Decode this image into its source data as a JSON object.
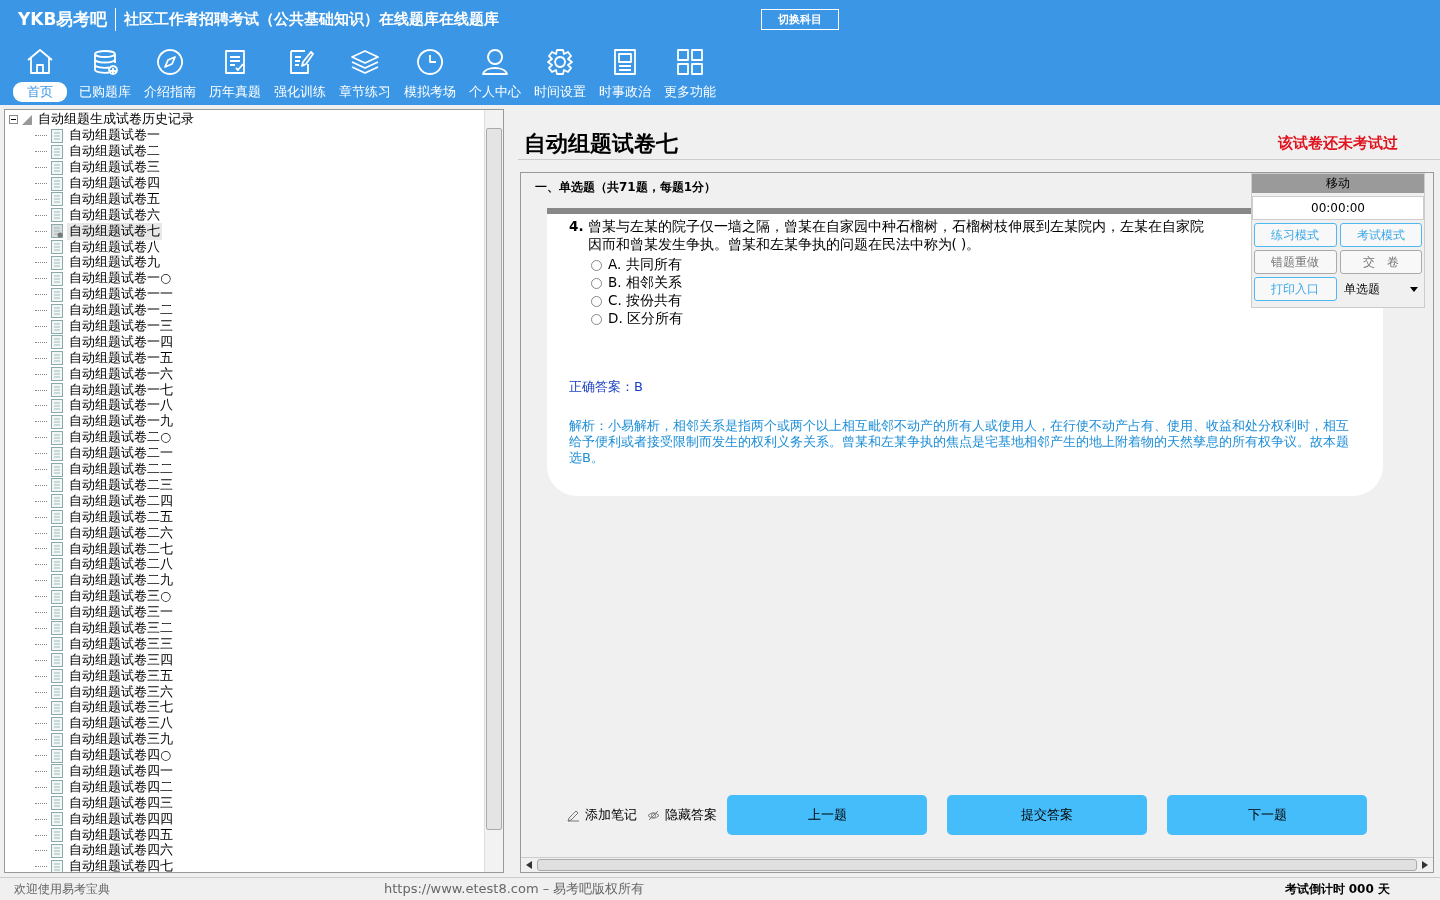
{
  "header": {
    "logo": "YKB易考吧",
    "title": "社区工作者招聘考试（公共基础知识）在线题库在线题库",
    "switch_button": "切换科目"
  },
  "nav": [
    {
      "label": "首页",
      "selected": true
    },
    {
      "label": "已购题库",
      "selected": false
    },
    {
      "label": "介绍指南",
      "selected": false
    },
    {
      "label": "历年真题",
      "selected": false
    },
    {
      "label": "强化训练",
      "selected": false
    },
    {
      "label": "章节练习",
      "selected": false
    },
    {
      "label": "模拟考场",
      "selected": false
    },
    {
      "label": "个人中心",
      "selected": false
    },
    {
      "label": "时间设置",
      "selected": false
    },
    {
      "label": "时事政治",
      "selected": false
    },
    {
      "label": "更多功能",
      "selected": false
    }
  ],
  "tree": {
    "root": {
      "label": "自动组题生成试卷历史记录",
      "expanded": true,
      "children": [
        {
          "label": "自动组题试卷一",
          "selected": false
        },
        {
          "label": "自动组题试卷二",
          "selected": false
        },
        {
          "label": "自动组题试卷三",
          "selected": false
        },
        {
          "label": "自动组题试卷四",
          "selected": false
        },
        {
          "label": "自动组题试卷五",
          "selected": false
        },
        {
          "label": "自动组题试卷六",
          "selected": false
        },
        {
          "label": "自动组题试卷七",
          "selected": true
        },
        {
          "label": "自动组题试卷八",
          "selected": false
        },
        {
          "label": "自动组题试卷九",
          "selected": false
        },
        {
          "label": "自动组题试卷一○",
          "selected": false
        },
        {
          "label": "自动组题试卷一一",
          "selected": false
        },
        {
          "label": "自动组题试卷一二",
          "selected": false
        },
        {
          "label": "自动组题试卷一三",
          "selected": false
        },
        {
          "label": "自动组题试卷一四",
          "selected": false
        },
        {
          "label": "自动组题试卷一五",
          "selected": false
        },
        {
          "label": "自动组题试卷一六",
          "selected": false
        },
        {
          "label": "自动组题试卷一七",
          "selected": false
        },
        {
          "label": "自动组题试卷一八",
          "selected": false
        },
        {
          "label": "自动组题试卷一九",
          "selected": false
        },
        {
          "label": "自动组题试卷二○",
          "selected": false
        },
        {
          "label": "自动组题试卷二一",
          "selected": false
        },
        {
          "label": "自动组题试卷二二",
          "selected": false
        },
        {
          "label": "自动组题试卷二三",
          "selected": false
        },
        {
          "label": "自动组题试卷二四",
          "selected": false
        },
        {
          "label": "自动组题试卷二五",
          "selected": false
        },
        {
          "label": "自动组题试卷二六",
          "selected": false
        },
        {
          "label": "自动组题试卷二七",
          "selected": false
        },
        {
          "label": "自动组题试卷二八",
          "selected": false
        },
        {
          "label": "自动组题试卷二九",
          "selected": false
        },
        {
          "label": "自动组题试卷三○",
          "selected": false
        },
        {
          "label": "自动组题试卷三一",
          "selected": false
        },
        {
          "label": "自动组题试卷三二",
          "selected": false
        },
        {
          "label": "自动组题试卷三三",
          "selected": false
        },
        {
          "label": "自动组题试卷三四",
          "selected": false
        },
        {
          "label": "自动组题试卷三五",
          "selected": false
        },
        {
          "label": "自动组题试卷三六",
          "selected": false
        },
        {
          "label": "自动组题试卷三七",
          "selected": false
        },
        {
          "label": "自动组题试卷三八",
          "selected": false
        },
        {
          "label": "自动组题试卷三九",
          "selected": false
        },
        {
          "label": "自动组题试卷四○",
          "selected": false
        },
        {
          "label": "自动组题试卷四一",
          "selected": false
        },
        {
          "label": "自动组题试卷四二",
          "selected": false
        },
        {
          "label": "自动组题试卷四三",
          "selected": false
        },
        {
          "label": "自动组题试卷四四",
          "selected": false
        },
        {
          "label": "自动组题试卷四五",
          "selected": false
        },
        {
          "label": "自动组题试卷四六",
          "selected": false
        },
        {
          "label": "自动组题试卷四七",
          "selected": false
        }
      ]
    }
  },
  "paper": {
    "title": "自动组题试卷七",
    "status": "该试卷还未考试过",
    "section": "一、单选题（共71题，每题1分）",
    "question": {
      "number": "4.",
      "text": "曾某与左某的院子仅一墙之隔，曾某在自家园中种石榴树，石榴树枝伸展到左某院内，左某在自家院",
      "text_2": "因而和曾某发生争执。曾某和左某争执的问题在民法中称为( )。",
      "options": [
        {
          "label": "A. 共同所有",
          "selected": false
        },
        {
          "label": "B. 相邻关系",
          "selected": false
        },
        {
          "label": "C. 按份共有",
          "selected": false
        },
        {
          "label": "D. 区分所有",
          "selected": false
        }
      ],
      "answer": "正确答案：B",
      "analysis": "解析：小易解析，相邻关系是指两个或两个以上相互毗邻不动产的所有人或使用人，在行使不动产占有、使用、收益和处分权利时，相互给予便利或者接受限制而发生的权利义务关系。曾某和左某争执的焦点是宅基地相邻产生的地上附着物的天然孳息的所有权争议。故本题选B。"
    },
    "tools": [
      {
        "label": "添加笔记",
        "kind": "pencil"
      },
      {
        "label": "隐藏答案",
        "kind": "eye"
      }
    ],
    "buttons": [
      "上一题",
      "提交答案",
      "下一题"
    ]
  },
  "panel": {
    "title": "移动",
    "timer": "00:00:00",
    "buttons": [
      {
        "label": "练习模式",
        "disabled": false
      },
      {
        "label": "考试模式",
        "disabled": false
      },
      {
        "label": "错题重做",
        "disabled": true
      },
      {
        "label": "交　卷",
        "disabled": true
      },
      {
        "label": "打印入口",
        "disabled": false
      }
    ],
    "dropdown": "单选题"
  },
  "status_bar": {
    "welcome": "欢迎使用易考宝典",
    "copyright": "https://www.etest8.com – 易考吧版权所有",
    "countdown": "考试倒计时 000 天"
  }
}
